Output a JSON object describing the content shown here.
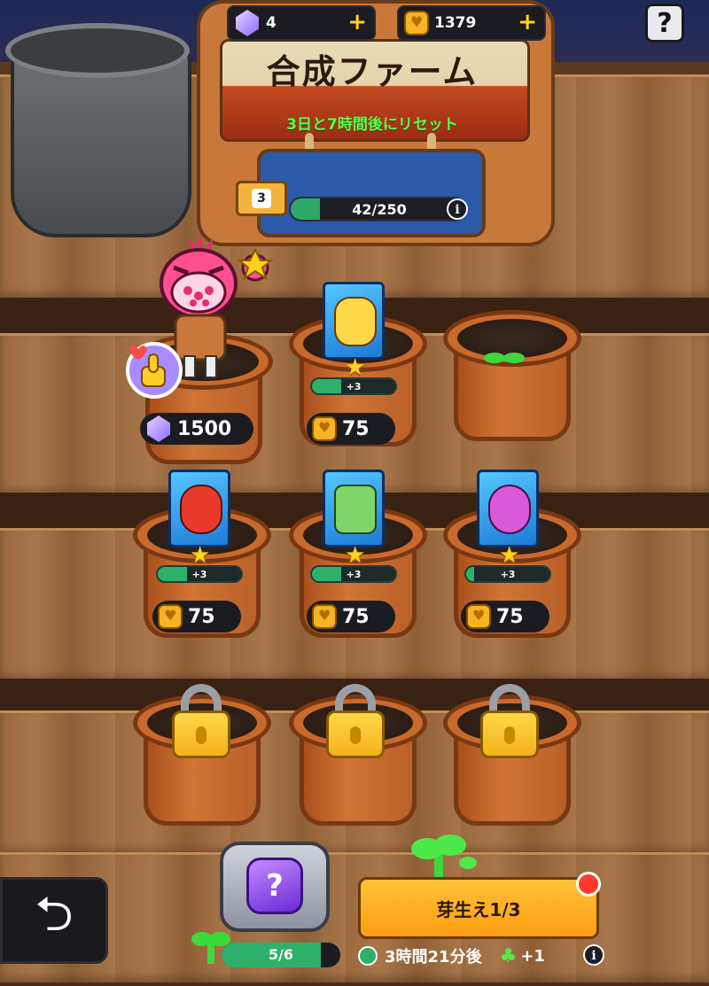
{
  "header": {
    "gems": "4",
    "coins": "1379",
    "help_label": "?",
    "plus_label": "+"
  },
  "sign": {
    "title": "合成ファーム",
    "reset_text": "3日と7時間後にリセット",
    "level": "3",
    "xp": "42/250",
    "xp_progress": 0.168
  },
  "pots": [
    {
      "row": 1,
      "type": "character",
      "price": "1500",
      "currency": "gem"
    },
    {
      "row": 1,
      "type": "card",
      "stars": 1,
      "progress_label": "+3",
      "progress": 0.35,
      "price": "75",
      "currency": "coin"
    },
    {
      "row": 1,
      "type": "sprout"
    },
    {
      "row": 2,
      "type": "card",
      "stars": 1,
      "progress_label": "+3",
      "progress": 0.35,
      "price": "75",
      "currency": "coin"
    },
    {
      "row": 2,
      "type": "card",
      "stars": 1,
      "progress_label": "+3",
      "progress": 0.35,
      "price": "75",
      "currency": "coin"
    },
    {
      "row": 2,
      "type": "card",
      "stars": 1,
      "progress_label": "+3",
      "progress": 0.1,
      "price": "75",
      "currency": "coin"
    },
    {
      "row": 3,
      "type": "locked"
    },
    {
      "row": 3,
      "type": "locked"
    },
    {
      "row": 3,
      "type": "locked"
    }
  ],
  "bottom": {
    "chest_label": "?",
    "sprouts": "5/6",
    "sprouts_progress": 0.833,
    "sprout_button": "芽生え1/3",
    "timer": "3時間21分後",
    "bonus": "+1"
  },
  "colors": {
    "accent_yellow": "#ffd21c",
    "progress_green": "#2fb06a",
    "reset_green": "#5dff4a"
  }
}
